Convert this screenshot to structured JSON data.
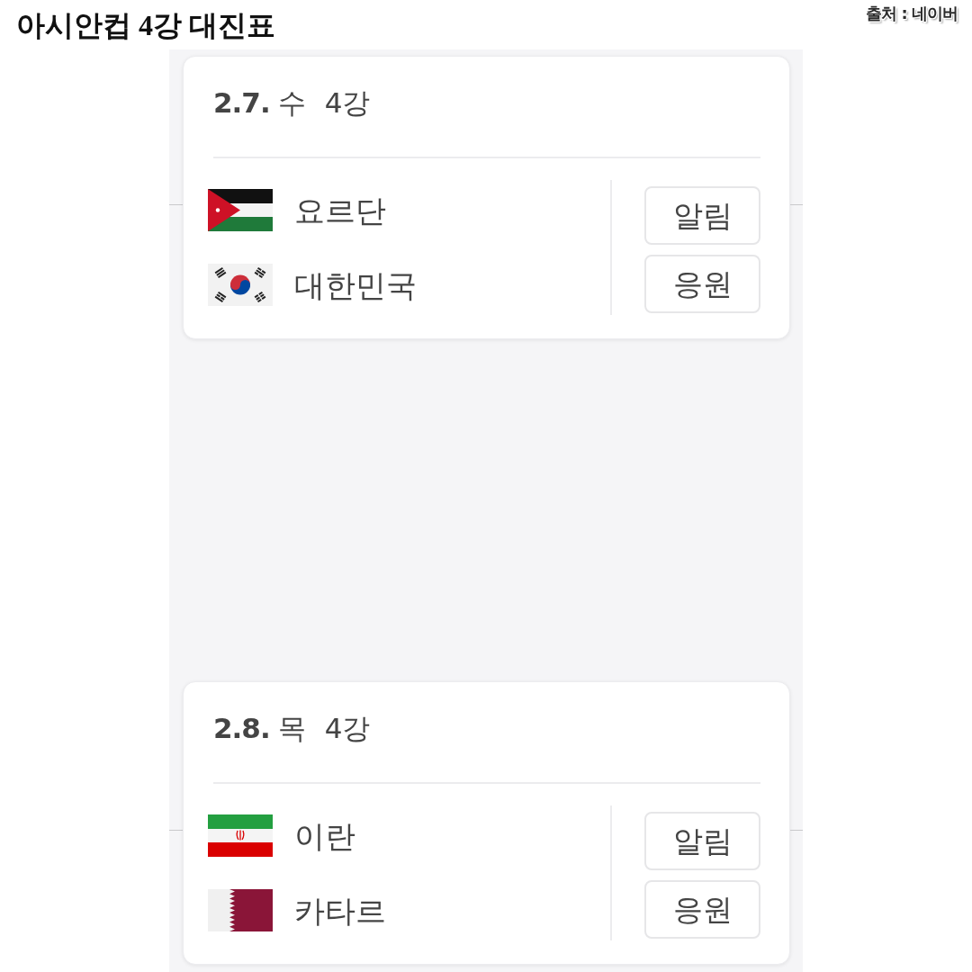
{
  "title": "아시안컵 4강 대진표",
  "source": "출처 : 네이버",
  "matches": [
    {
      "date": "2.7.",
      "weekday": "수",
      "round": "4강",
      "teams": [
        {
          "name": "요르단",
          "kind": "jordan"
        },
        {
          "name": "대한민국",
          "kind": "korea"
        }
      ],
      "buttons": [
        "알림",
        "응원"
      ]
    },
    {
      "date": "2.8.",
      "weekday": "목",
      "round": "4강",
      "teams": [
        {
          "name": "이란",
          "kind": "iran"
        },
        {
          "name": "카타르",
          "kind": "qatar"
        }
      ],
      "buttons": [
        "알림",
        "응원"
      ]
    }
  ]
}
